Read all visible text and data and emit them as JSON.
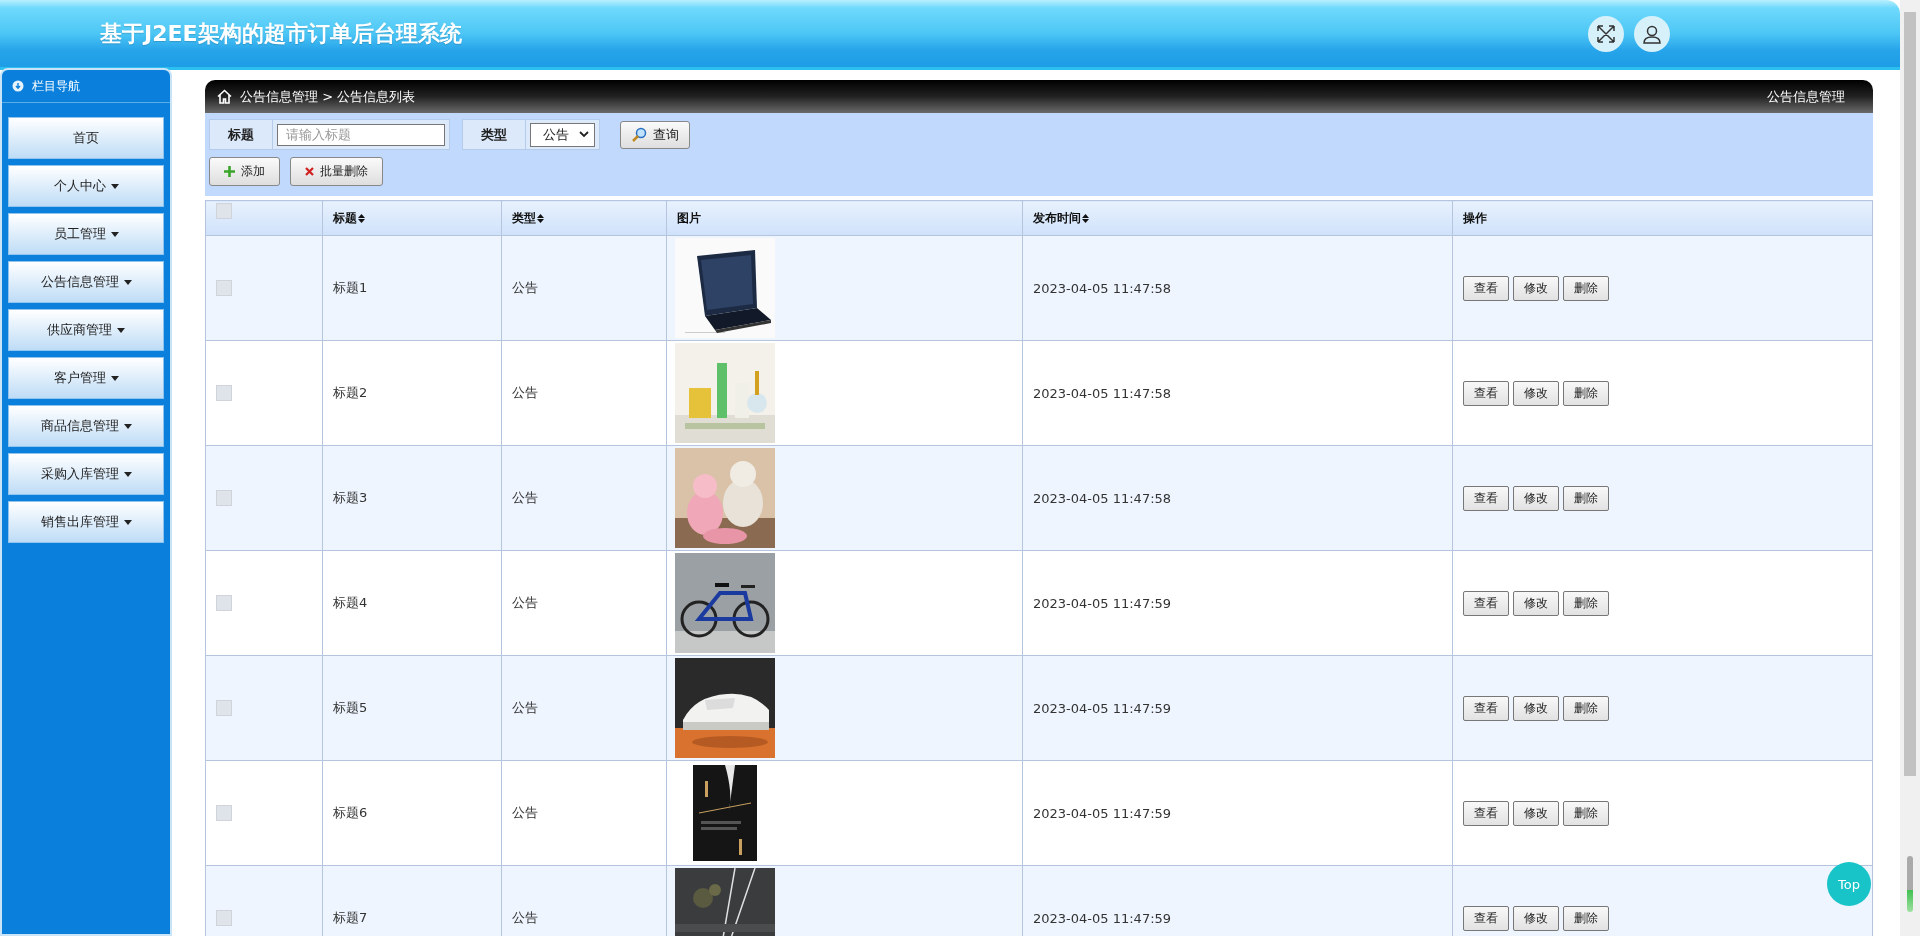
{
  "header": {
    "title": "基于J2EE架构的超市订单后台理系统"
  },
  "sidebar": {
    "title": "栏目导航",
    "items": [
      {
        "label": "首页",
        "has_menu": false
      },
      {
        "label": "个人中心",
        "has_menu": true
      },
      {
        "label": "员工管理",
        "has_menu": true
      },
      {
        "label": "公告信息管理",
        "has_menu": true
      },
      {
        "label": "供应商管理",
        "has_menu": true
      },
      {
        "label": "客户管理",
        "has_menu": true
      },
      {
        "label": "商品信息管理",
        "has_menu": true
      },
      {
        "label": "采购入库管理",
        "has_menu": true
      },
      {
        "label": "销售出库管理",
        "has_menu": true
      }
    ]
  },
  "breadcrumb": {
    "items": [
      "公告信息管理",
      "公告信息列表"
    ],
    "separator": ">",
    "right_title": "公告信息管理"
  },
  "search": {
    "fields": [
      {
        "label": "标题",
        "kind": "text",
        "placeholder": "请输入标题"
      },
      {
        "label": "类型",
        "kind": "select",
        "value": "公告"
      }
    ],
    "query_button": "查询"
  },
  "actions": [
    {
      "label": "添加",
      "kind": "add"
    },
    {
      "label": "批量删除",
      "kind": "delete"
    }
  ],
  "table": {
    "select_all": {
      "checked": false
    },
    "columns": [
      {
        "label": "标题",
        "sortable": true
      },
      {
        "label": "类型",
        "sortable": true
      },
      {
        "label": "图片",
        "sortable": false
      },
      {
        "label": "发布时间",
        "sortable": true
      },
      {
        "label": "操作",
        "sortable": false
      }
    ],
    "rows": [
      {
        "checked": false,
        "title": "标题1",
        "type": "公告",
        "time": "2023-04-05 11:47:58",
        "buttons": [
          "查看",
          "修改",
          "删除"
        ]
      },
      {
        "checked": false,
        "title": "标题2",
        "type": "公告",
        "time": "2023-04-05 11:47:58",
        "buttons": [
          "查看",
          "修改",
          "删除"
        ]
      },
      {
        "checked": false,
        "title": "标题3",
        "type": "公告",
        "time": "2023-04-05 11:47:58",
        "buttons": [
          "查看",
          "修改",
          "删除"
        ]
      },
      {
        "checked": false,
        "title": "标题4",
        "type": "公告",
        "time": "2023-04-05 11:47:59",
        "buttons": [
          "查看",
          "修改",
          "删除"
        ]
      },
      {
        "checked": false,
        "title": "标题5",
        "type": "公告",
        "time": "2023-04-05 11:47:59",
        "buttons": [
          "查看",
          "修改",
          "删除"
        ]
      },
      {
        "checked": false,
        "title": "标题6",
        "type": "公告",
        "time": "2023-04-05 11:47:59",
        "buttons": [
          "查看",
          "修改",
          "删除"
        ]
      },
      {
        "checked": false,
        "title": "标题7",
        "type": "公告",
        "time": "2023-04-05 11:47:59",
        "buttons": [
          "查看",
          "修改",
          "删除"
        ]
      }
    ]
  },
  "top_button": "Top"
}
